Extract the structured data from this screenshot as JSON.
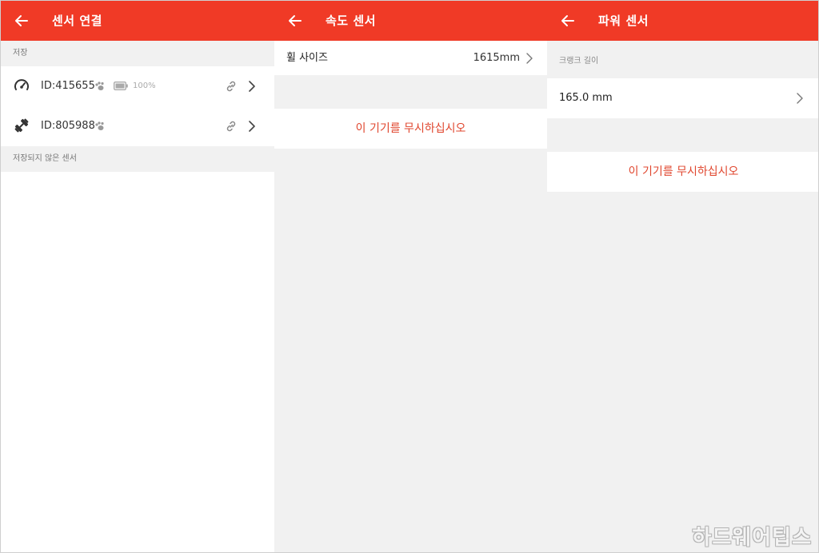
{
  "colors": {
    "accent": "#f03a26",
    "ignore_text": "#e0462e",
    "background": "#f1f1f1"
  },
  "panel1": {
    "title": "센서 연결",
    "saved_header": "저장",
    "sensors": [
      {
        "icon": "speedometer-icon",
        "id": "ID:415655",
        "battery": "100%"
      },
      {
        "icon": "dumbbell-icon",
        "id": "ID:805988"
      }
    ],
    "unsaved_header": "저장되지 않은 센서"
  },
  "panel2": {
    "title": "속도 센서",
    "wheel_size_label": "휠 사이즈",
    "wheel_size_value": "1615mm",
    "ignore_label": "이 기기를 무시하십시오"
  },
  "panel3": {
    "title": "파워 센서",
    "crank_header": "크랭크 길이",
    "crank_value": "165.0 mm",
    "ignore_label": "이 기기를 무시하십시오"
  },
  "watermark": "하드웨어팁스"
}
